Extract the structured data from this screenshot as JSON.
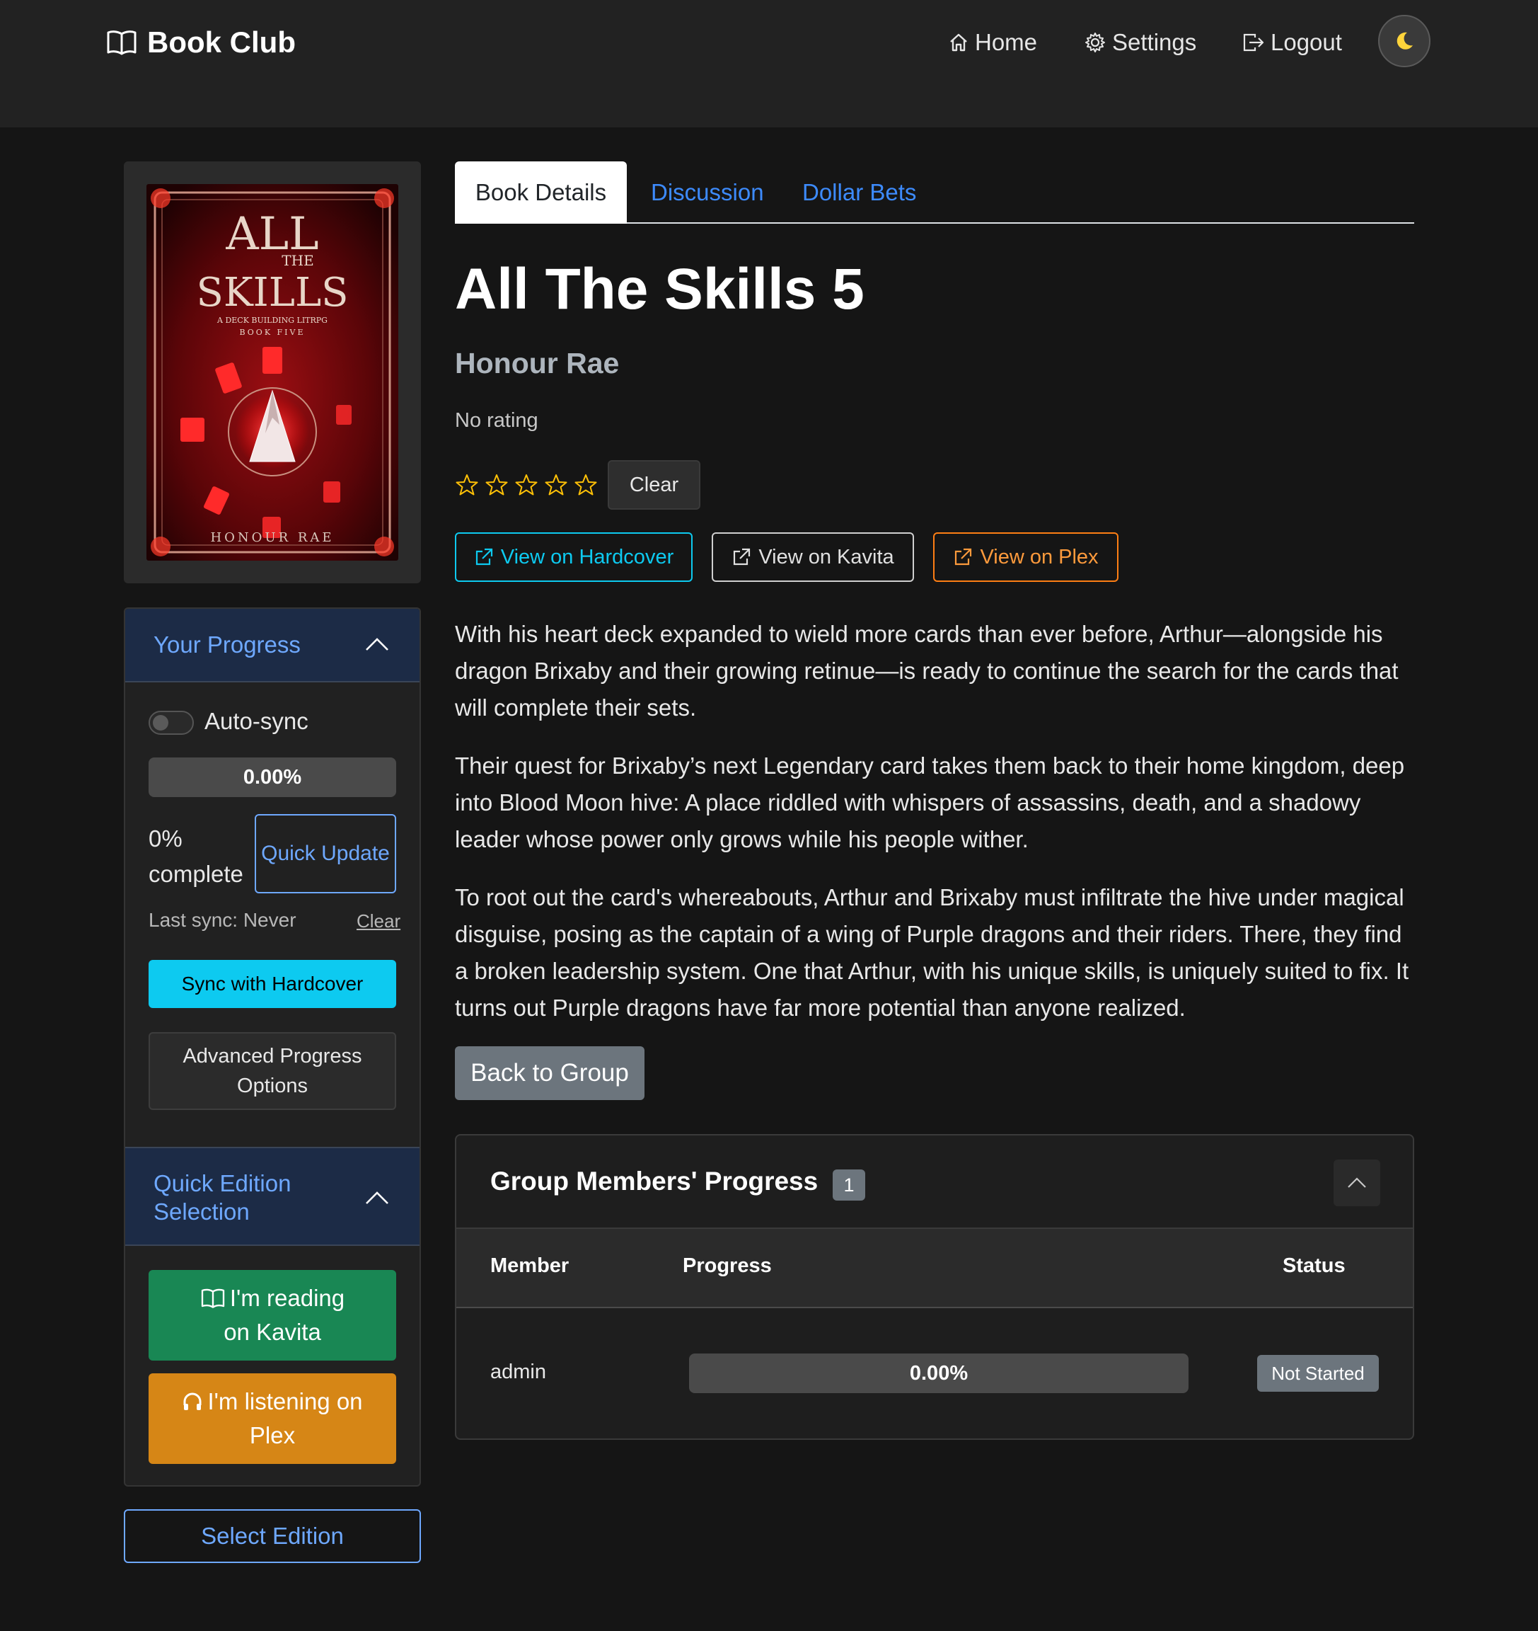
{
  "nav": {
    "brand": "Book Club",
    "home": "Home",
    "settings": "Settings",
    "logout": "Logout"
  },
  "cover": {
    "title_line1": "ALL",
    "title_line2": "THE",
    "title_line3": "SKILLS",
    "subtitle_line1": "A DECK BUILDING LITRPG",
    "subtitle_line2": "BOOK FIVE",
    "author": "HONOUR RAE"
  },
  "progress_panel": {
    "title": "Your Progress",
    "autosync_label": "Auto-sync",
    "autosync_on": false,
    "progress_fraction": 0.0,
    "progress_label": "0.00%",
    "complete_text": "0% complete",
    "quick_update_label": "Quick Update",
    "last_sync": "Last sync: Never",
    "clear_label": "Clear",
    "sync_button": "Sync with Hardcover",
    "advanced_button": "Advanced Progress Options"
  },
  "edition_panel": {
    "title": "Quick Edition Selection",
    "kavita_button": "I'm reading on Kavita",
    "plex_button": "I'm listening on Plex",
    "select_edition": "Select Edition"
  },
  "tabs": [
    {
      "label": "Book Details",
      "active": true
    },
    {
      "label": "Discussion",
      "active": false
    },
    {
      "label": "Dollar Bets",
      "active": false
    }
  ],
  "book": {
    "title": "All The Skills 5",
    "author": "Honour Rae",
    "rating_text": "No rating",
    "stars_filled": 0,
    "stars_total": 5,
    "clear_rating": "Clear",
    "links": {
      "hardcover": "View on Hardcover",
      "kavita": "View on Kavita",
      "plex": "View on Plex"
    },
    "description": [
      "With his heart deck expanded to wield more cards than ever before, Arthur—alongside his dragon Brixaby and their growing retinue—is ready to continue the search for the cards that will complete their sets.",
      "Their quest for Brixaby’s next Legendary card takes them back to their home kingdom, deep into Blood Moon hive: A place riddled with whispers of assassins, death, and a shadowy leader whose power only grows while his people wither.",
      "To root out the card's whereabouts, Arthur and Brixaby must infiltrate the hive under magical disguise, posing as the captain of a wing of Purple dragons and their riders. There, they find a broken leadership system. One that Arthur, with his unique skills, is uniquely suited to fix. It turns out Purple dragons have far more potential than anyone realized."
    ],
    "back_button": "Back to Group"
  },
  "members": {
    "title": "Group Members' Progress",
    "count": "1",
    "columns": [
      "Member",
      "Progress",
      "Status"
    ],
    "rows": [
      {
        "member": "admin",
        "progress_fraction": 0.0,
        "progress_label": "0.00%",
        "status": "Not Started"
      }
    ]
  },
  "colors": {
    "accent_blue": "#6ea8fe",
    "info": "#0dcaf0",
    "success": "#198754",
    "warning": "#d68616",
    "secondary": "#6c757d"
  }
}
